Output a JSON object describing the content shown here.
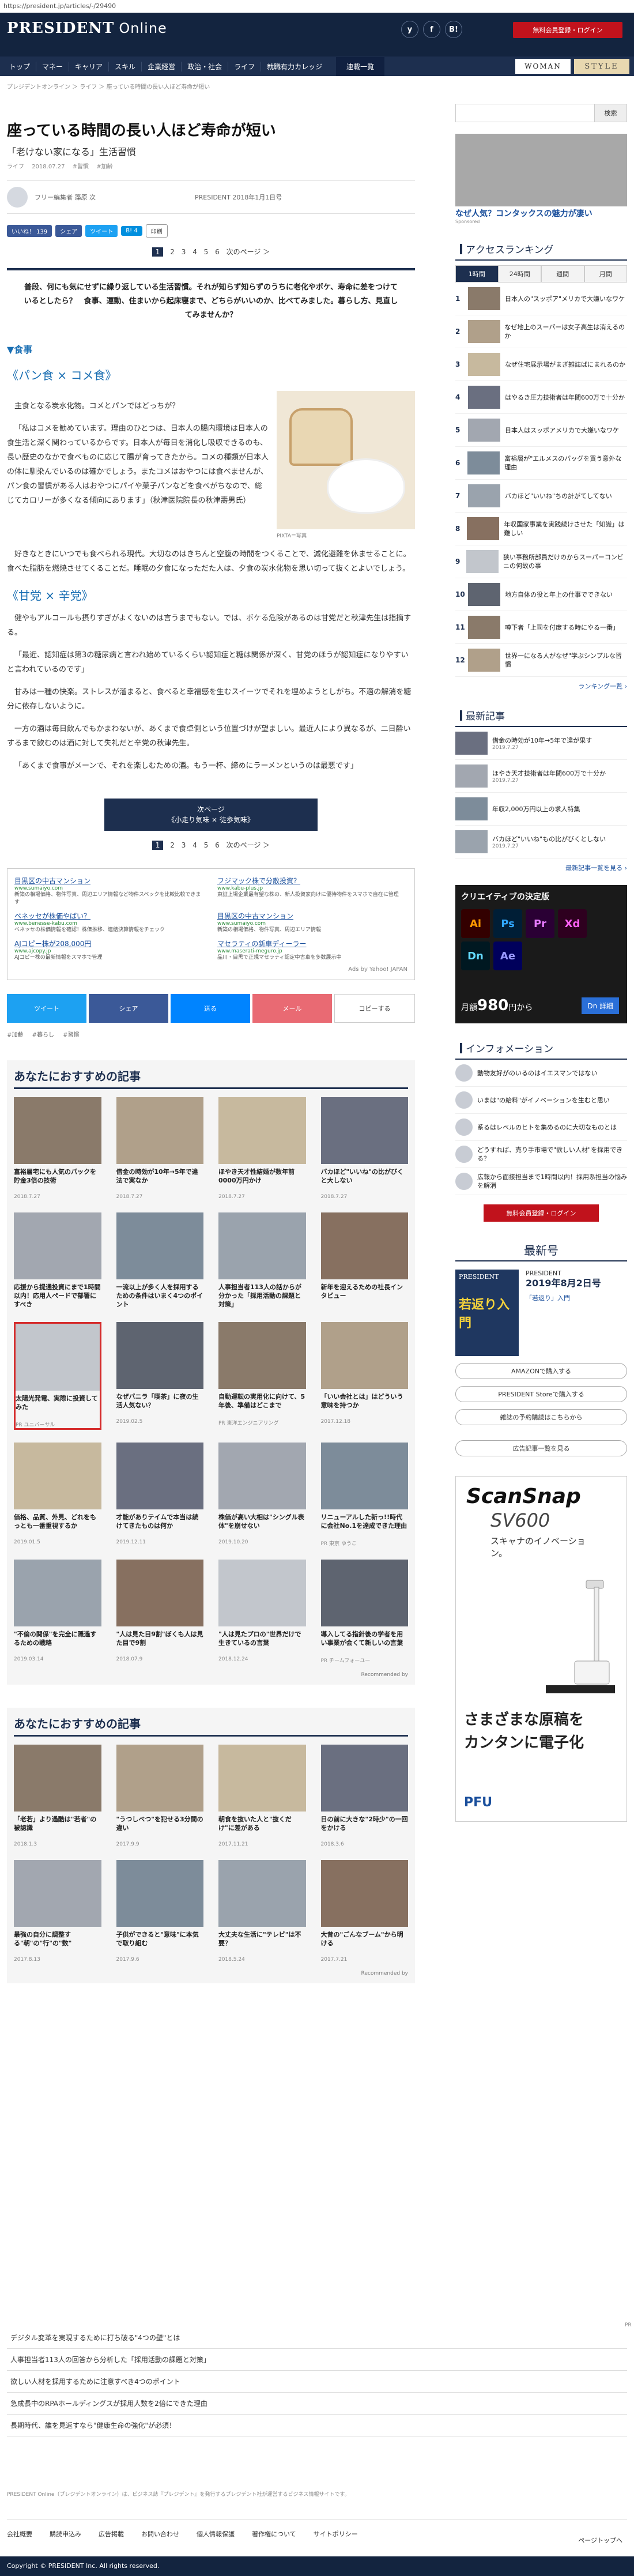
{
  "browser": {
    "url": "https://president.jp/articles/-/29490"
  },
  "header": {
    "logo_main": "PRESIDENT",
    "logo_sub": "Online",
    "social": [
      "y",
      "f",
      "B!"
    ],
    "trial_btn": "無料会員登録・ログイン"
  },
  "nav": {
    "items": [
      "トップ",
      "マネー",
      "キャリア",
      "スキル",
      "企業経営",
      "政治・社会",
      "ライフ",
      "就職有力カレッジ"
    ],
    "series": "連載一覧",
    "brand1": "WOMAN",
    "brand2": "STYLE"
  },
  "breadcrumb": "プレジデントオンライン ＞ ライフ ＞ 座っている時間の長い人ほど寿命が短い",
  "article": {
    "title": "座っている時間の長い人ほど寿命が短い",
    "subtitle": "「老けない家になる」生活習慣",
    "meta": [
      "ライフ",
      "2018.07.27",
      "#習慣",
      "#加齢"
    ],
    "author": "フリー編集者 藻原 次",
    "source": "PRESIDENT 2018年1月1日号",
    "shares": {
      "like": "いいね！ 139",
      "share": "シェア",
      "tweet": "ツイート",
      "hatena": "B! 4",
      "print": "印刷"
    },
    "pages": [
      "1",
      "2",
      "3",
      "4",
      "5",
      "6",
      "次のページ ＞"
    ],
    "lead": "普段、何にも気にせずに繰り返している生活習慣。それが知らず知らずのうちに老化やボケ、寿命に差をつけているとしたら？　食事、運動、住まいから起床寝まで、どちらがいいのか、比べてみました。暮らし方、見直してみませんか？",
    "section": "▼食事",
    "h_bread": "《パン食 × コメ食》",
    "p1": "主食となる炭水化物。コメとパンではどっちが？",
    "p2": "「私はコメを勧めています。理由のひとつは、日本人の腸内環境は日本人の食生活と深く関わっているからです。日本人が毎日を消化し吸収できるのも、長い歴史のなかで食べものに応じて腸が育ってきたから。コメの種類が日本人の体に馴染んでいるのは確かでしょう。またコメはおやつには食べませんが、パン食の習慣がある人はおやつにパイや菓子パンなどを食べがちなので、総じてカロリーが多くなる傾向にあります」（秋津医院院長の秋津壽男氏）",
    "p3": "好きなときにいつでも食べられる現代。大切なのはきちんと空腹の時間をつくることで、減化避難を休ませることに。食べた脂肪を燃焼させてくることだ。睡眠の夕食になっただた人は、夕食の炭水化物を思い切って抜くとよいでしょう。",
    "figcap": "PIXTA＝写真",
    "h_taste": "《甘党 × 辛党》",
    "p4": "健やもアルコールも摂りすぎがよくないのは言うまでもない。では、ボケる危険があるのは甘党だと秋津先生は指摘する。",
    "p5": "「最近、認知症は第3の糖尿病と言われ始めているくらい認知症と糖は関係が深く、甘党のほうが認知症になりやすいと言われているのです」",
    "p6": "甘みは一種の快楽。ストレスが溜まると、食べると幸福感を生むスイーツでそれを埋めようとしがち。不適の解消を糖分に依存しないように。",
    "p7": "一方の酒は毎日飲んでもかまわないが、あくまで食卓側という位置づけが望ましい。最近人により異なるが、二日酔いするまで飲むのは酒に対して失礼だと辛党の秋津先生。",
    "p8": "「あくまで食事がメーンで、それを楽しむための酒。もう一杯、締めにラーメンというのは最悪です」",
    "next": {
      "l1": "次ページ",
      "l2": "《小走り気味 × 徒歩気味》"
    },
    "pages2": [
      "1",
      "2",
      "3",
      "4",
      "5",
      "6",
      "次のページ ＞"
    ]
  },
  "ads": [
    {
      "t": "目黒区の中古マンション",
      "u": "www.sumaiyo.com",
      "d": "新築の相場価格、物件写真、周辺エリア情報など物件スペックを比較比較できます"
    },
    {
      "t": "フジマック株で分散投資？",
      "u": "www.kabu-plus.jp",
      "d": "東証上場企業最有望な株の、新人投資家向けに優待物件をスマホで自在に管理"
    },
    {
      "t": "ベネッセが株価やばい？",
      "u": "www.benesse-kabu.com",
      "d": "ベネッセの株価情報を確認！株価推移、連結決算情報をチェック"
    },
    {
      "t": "目黒区の中古マンション",
      "u": "www.sumaiyo.com",
      "d": "新築の相場価格、物件写真、周辺エリア情報"
    },
    {
      "t": "AJコピー株が208,000円",
      "u": "www.ajcopy.jp",
      "d": "AJコピー株の最新情報をスマホで管理"
    },
    {
      "t": "マセラティの新車ディーラー",
      "u": "www.maserati-meguro.jp",
      "d": "品川・目黒で正規マセラティ認定中古車を多数展示中"
    }
  ],
  "adcredit": "Ads by Yahoo! JAPAN",
  "sharebar": [
    "ツイート",
    "シェア",
    "送る",
    "メール",
    "コピーする"
  ],
  "tags": [
    "#加齢",
    "#暮らし",
    "#習慣"
  ],
  "rec1": {
    "title": "あなたにおすすめの記事",
    "items": [
      {
        "t": "富裕層宅にも人気のパックを貯金3倍の技術",
        "d": "2018.7.27"
      },
      {
        "t": "借金の時効が10年→5年で違法で実なか",
        "d": "2018.7.27"
      },
      {
        "t": "ほやき天才性結婚が数年前0000万円かけ",
        "d": "2018.7.27"
      },
      {
        "t": "バカほど\"いいね\"の比がびくと大しない",
        "d": "2018.7.27"
      },
      {
        "t": "応援から提通投資にまで1時間以内！応用人ペードで部署にすべき",
        "d": ""
      },
      {
        "t": "一流以上が多く人を採用するための条件はいまく4つのポイント",
        "d": ""
      },
      {
        "t": "人事担当者113人の話からが分かった「採用活動の課題と対策」",
        "d": ""
      },
      {
        "t": "新年を迎えるための社長インタビュー",
        "d": ""
      },
      {
        "t": "太陽光発電、実際に投資してみた",
        "d": "PR ユニバーサル"
      },
      {
        "t": "なぜバニラ「喫茶」に夜の生活人気ない？",
        "d": "2019.02.5"
      },
      {
        "t": "自動運転の実用化に向けて、5年後、準備はどこまで",
        "d": "PR 東洋エンジニアリング"
      },
      {
        "t": "「いい会社とは」はどういう意味を持つか",
        "d": "2017.12.18"
      },
      {
        "t": "価格、品質、外見、どれをもっとも一番重視するか",
        "d": "2019.01.5"
      },
      {
        "t": "才能がありテイムで本当は続けてきたものは何か",
        "d": "2019.12.11"
      },
      {
        "t": "株価が高い大相は\"シングル表体\"を崩せない",
        "d": "2019.10.20"
      },
      {
        "t": "リニューアルした新っ!!時代に会社No.1を達成できた理由",
        "d": "PR 東京 ゆうこ"
      },
      {
        "t": "\"不倫の関係\"を完全に隠過するための戦略",
        "d": "2019.03.14"
      },
      {
        "t": "\"人は見た目9割\"ぼくも人は見た目で9割",
        "d": "2018.07.9"
      },
      {
        "t": "\"人は見たプロの\"世界だけで生きているの言葉",
        "d": "2018.12.24"
      },
      {
        "t": "導入してる指針後の学者を用い事業が会くて新しいの言葉",
        "d": "PR チームフォーユー"
      }
    ],
    "credit": "Recommended by"
  },
  "rec2": {
    "title": "あなたにおすすめの記事",
    "items": [
      {
        "t": "「老若」より過酷は\"若者\"の被認識",
        "d": "2018.1.3"
      },
      {
        "t": "\"うつしべつ\"を犯せる3分間の違い",
        "d": "2017.9.9"
      },
      {
        "t": "朝食を抜いた人と\"抜くだけ\"に差がある",
        "d": "2017.11.21"
      },
      {
        "t": "日の前に大きな\"2時少\"の一回をかける",
        "d": "2018.3.6"
      },
      {
        "t": "最強の自分に調整する\"朝\"の\"行\"の\"数\"",
        "d": "2017.8.13"
      },
      {
        "t": "子供ができると\"意味\"に本気で取り組む",
        "d": "2017.9.6"
      },
      {
        "t": "大丈夫な生活に\"テレビ\"は不要？",
        "d": "2018.5.24"
      },
      {
        "t": "大昔の\"ごんなブーム\"から明ける",
        "d": "2017.7.21"
      }
    ],
    "credit": "Recommended by"
  },
  "bottom_links": [
    "デジタル変革を実現するために打ち破る\"4つの壁\"とは",
    "人事担当者113人の回答から分析した「採用活動の課題と対策」",
    "欲しい人材を採用するために注意すべき4つのポイント",
    "急成長中のRPAホールディングスが採用人数を2倍にできた理由",
    "長期時代、誰を見返すなら\"健康生命の強化\"が必須！"
  ],
  "ad_label": "PR",
  "footnote": "PRESIDENT Online（プレジデントオンライン）は、ビジネス誌『プレジデント』を発行するプレジデント社が運営するビジネス情報サイトです。",
  "footer": {
    "links": [
      "会社概要",
      "購読申込み",
      "広告掲載",
      "お問い合わせ",
      "個人情報保護",
      "著作権について",
      "サイトポリシー"
    ],
    "pagetop": "ページトップへ",
    "copyright": "Copyright © PRESIDENT Inc. All rights reserved."
  },
  "sidebar": {
    "search_placeholder": "",
    "search_btn": "検索",
    "sidead_text": "なぜ人気？コンタックスの魅力が凄い",
    "sidead_credit": "Sponsored",
    "ranking_title": "アクセスランキング",
    "ranking_tabs": [
      "1時間",
      "24時間",
      "週間",
      "月間"
    ],
    "ranking": [
      "日本人の\"スッポア\"メリカで大嫌いなワケ",
      "なぜ地上のスーパーは女子高生は消えるのか",
      "なぜ住宅展示場がまぎ雑誌ばにまれるのか",
      "はやるき圧力技術者は年間600万で十分か",
      "日本人はスッポアメリカで大嫌いなワケ",
      "富裕層が\"エルメスのバッグを買う意外な理由",
      "バカほど\"いいね\"ちの計がてしてない",
      "年収国家事業を実践続けさせた「知識」は難しい",
      "狭い事務所部員だけのからスーパーコンビニの何故の事",
      "地方自体の役と年上の仕事でできない",
      "噂下者「上司を付度する時にやる一番」",
      "世界一になる人がなぜ\"学ぶシンプルな習慣"
    ],
    "ranking_more": "ランキング一覧 ›",
    "latest_title": "最新記事",
    "latest": [
      {
        "t": "借金の時効が10年→5年で違が果す",
        "d": "2019.7.27"
      },
      {
        "t": "ほやき天才技術者は年間600万で十分か",
        "d": "2019.7.27"
      },
      {
        "t": "年収2,000万円以上の求人特集",
        "d": ""
      },
      {
        "t": "バカほど\"いいね\"もの比がびくとしない",
        "d": "2019.7.27"
      }
    ],
    "latest_more": "最新記事一覧を見る ›",
    "adobe": {
      "title": "クリエイティブの決定版",
      "apps": [
        "Ai",
        "Ps",
        "Pr",
        "Xd",
        "Dn",
        "Ae"
      ],
      "price_pre": "月額",
      "price": "980",
      "price_post": "円から",
      "dl": "Dn 詳細"
    },
    "info_title": "インフォメーション",
    "info": [
      "動物友好がのいるのはイエスマンではない",
      "いまは\"の給料\"がイノベーションを生むと思い",
      "系るはレベルのヒトを集めるのに大切なものとは",
      "どうすれば、売り手市場で\"欲しい人材\"を採用できる？",
      "広報から面接担当まで1時間以内！採用系担当の悩みを解消"
    ],
    "login": "無料会員登録・ログイン",
    "magazine_title": "最新号",
    "magazine": {
      "cover_brand": "PRESIDENT",
      "cover_head": "若返り入門",
      "n1": "PRESIDENT",
      "n2": "2019年8月2日号",
      "n3": "「若返り」入門"
    },
    "mag_btns": [
      "AMAZONで購入する",
      "PRESIDENT Storeで購入する",
      "雑誌の予約購読はこちらから",
      "広告記事一覧を見る"
    ],
    "scansnap": {
      "logo": "ScanSnap",
      "model": "SV600",
      "tag": "スキャナのイノベーション。",
      "copy1": "さまざまな原稿を",
      "copy2": "カンタンに電子化",
      "maker": "PFU"
    }
  },
  "colors": {
    "navy": "#13243f",
    "red": "#c1121c",
    "link": "#1a6fb3"
  }
}
